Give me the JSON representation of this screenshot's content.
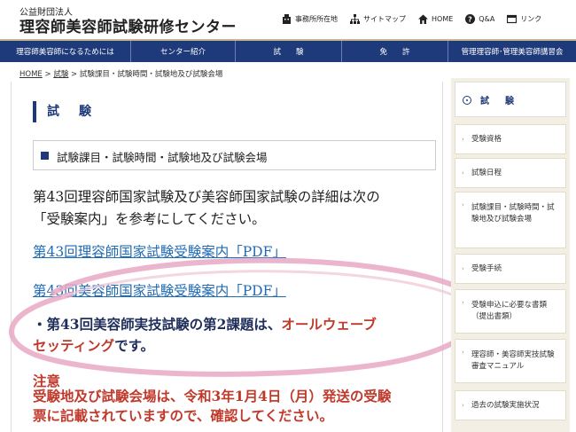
{
  "header": {
    "org_sub": "公益財団法人",
    "org_name": "理容師美容師試験研修センター",
    "links": [
      {
        "label": "事務所所在地",
        "icon": "building-icon"
      },
      {
        "label": "サイトマップ",
        "icon": "sitemap-icon"
      },
      {
        "label": "HOME",
        "icon": "home-icon"
      },
      {
        "label": "Q&A",
        "icon": "question-icon"
      },
      {
        "label": "リンク",
        "icon": "window-icon"
      }
    ]
  },
  "main_nav": [
    "理容師美容師になるためには",
    "センター紹介",
    "試　　験",
    "免　　許",
    "管理理容師･管理美容師講習会"
  ],
  "breadcrumb": {
    "home": "HOME",
    "sep1": " > ",
    "exam": "試験",
    "sep2": " > ",
    "current": "試験課目・試験時間・試験地及び試験会場"
  },
  "content": {
    "section_title": "試　験",
    "subheading": "試験課目・試験時間・試験地及び試験会場",
    "intro_line1": "第43回理容師国家試験及び美容師国家試験の詳細は次の",
    "intro_line2": "「受験案内」を参考にしてください。",
    "link_barber": "第43回理容師国家試験受験案内「PDF」",
    "link_beauty": "第43回美容師国家試験受験案内「PDF」",
    "bullet_prefix": "・第43回美容師実技試験の第2課題は、",
    "bullet_red1": "オールウェーブ",
    "bullet_red2": "セッティング",
    "bullet_suffix": "です。",
    "note_title": "注意",
    "note_line1": "受験地及び試験会場は、令和3年1月4日（月）発送の受験",
    "note_line2": "票に記載されていますので、確認してください。"
  },
  "sidebar": {
    "title": "試　験",
    "items": [
      "受験資格",
      "試験日程",
      "試験課目・試験時間・試験地及び試験会場",
      "受験手続",
      "受験申込に必要な書類（提出書類）",
      "理容師・美容師実技試験審査マニュアル",
      "過去の試験実施状況"
    ]
  },
  "colors": {
    "navy": "#1f3a7a",
    "link": "#1f6bb5",
    "warning_red": "#c0392b",
    "sidebar_bg": "#f3efe4",
    "highlight_pink": "#e8a9c4"
  }
}
